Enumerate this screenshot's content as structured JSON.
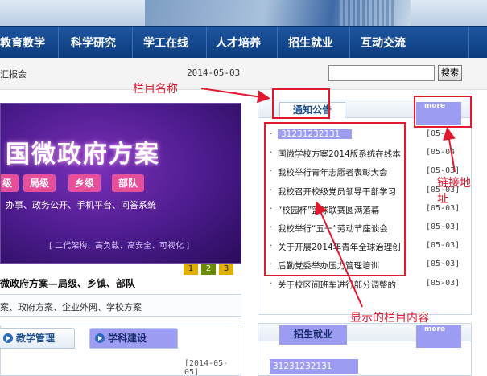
{
  "nav": {
    "items": [
      "教育教学",
      "科学研究",
      "学工在线",
      "人才培养",
      "招生就业",
      "互动交流"
    ]
  },
  "toolbar": {
    "left_text": "汇报会",
    "date": "2014-05-03",
    "search_value": "",
    "search_button": "搜索"
  },
  "feature": {
    "headline": "国微政府方案",
    "pills": [
      "级",
      "局级",
      "乡级",
      "部队"
    ],
    "subline": "办事、政务公开、手机平台、问答系统",
    "tagline": "[ 二代架构、高负载、高安全、可视化 ]",
    "dots": [
      "1",
      "2",
      "3"
    ],
    "caption": "微政府方案—局级、乡镇、部队"
  },
  "categories": {
    "text": "案、政府方案、企业外网、学校方案"
  },
  "tabs": {
    "items": [
      "教学管理",
      "学科建设"
    ],
    "date": "[2014-05-05]"
  },
  "notice_panel": {
    "title": "通知公告",
    "more": "more",
    "items": [
      {
        "title": "31231232131",
        "date": "[05-0"
      },
      {
        "title": "国微学校方案2014版系统在线本",
        "date": "[05-04"
      },
      {
        "title": "我校举行青年志愿者表彰大会",
        "date": "[05-03]"
      },
      {
        "title": "我校召开校级党员领导干部学习",
        "date": "[05-03]"
      },
      {
        "title": "“校园杯”篮球联赛圆满落幕",
        "date": "[05-03]"
      },
      {
        "title": "我校举行“五一”劳动节座谈会",
        "date": "[05-03]"
      },
      {
        "title": "关于开展2014年青年全球治理创",
        "date": "[05-03]"
      },
      {
        "title": "后勤党委举办压力管理培训",
        "date": "[05-03]"
      },
      {
        "title": "关于校区间班车进行部分调整的",
        "date": "[05-03]"
      }
    ]
  },
  "admissions_panel": {
    "title": "招生就业",
    "more": "more",
    "first_item": "31231232131"
  },
  "annotations": {
    "column_name": "栏目名称",
    "link_address": "链接地址",
    "content": "显示的栏目内容"
  },
  "colors": {
    "nav_bg": "#0c3c7e",
    "annotation_red": "#e0192f",
    "highlight_purple": "#9c9cf2"
  }
}
